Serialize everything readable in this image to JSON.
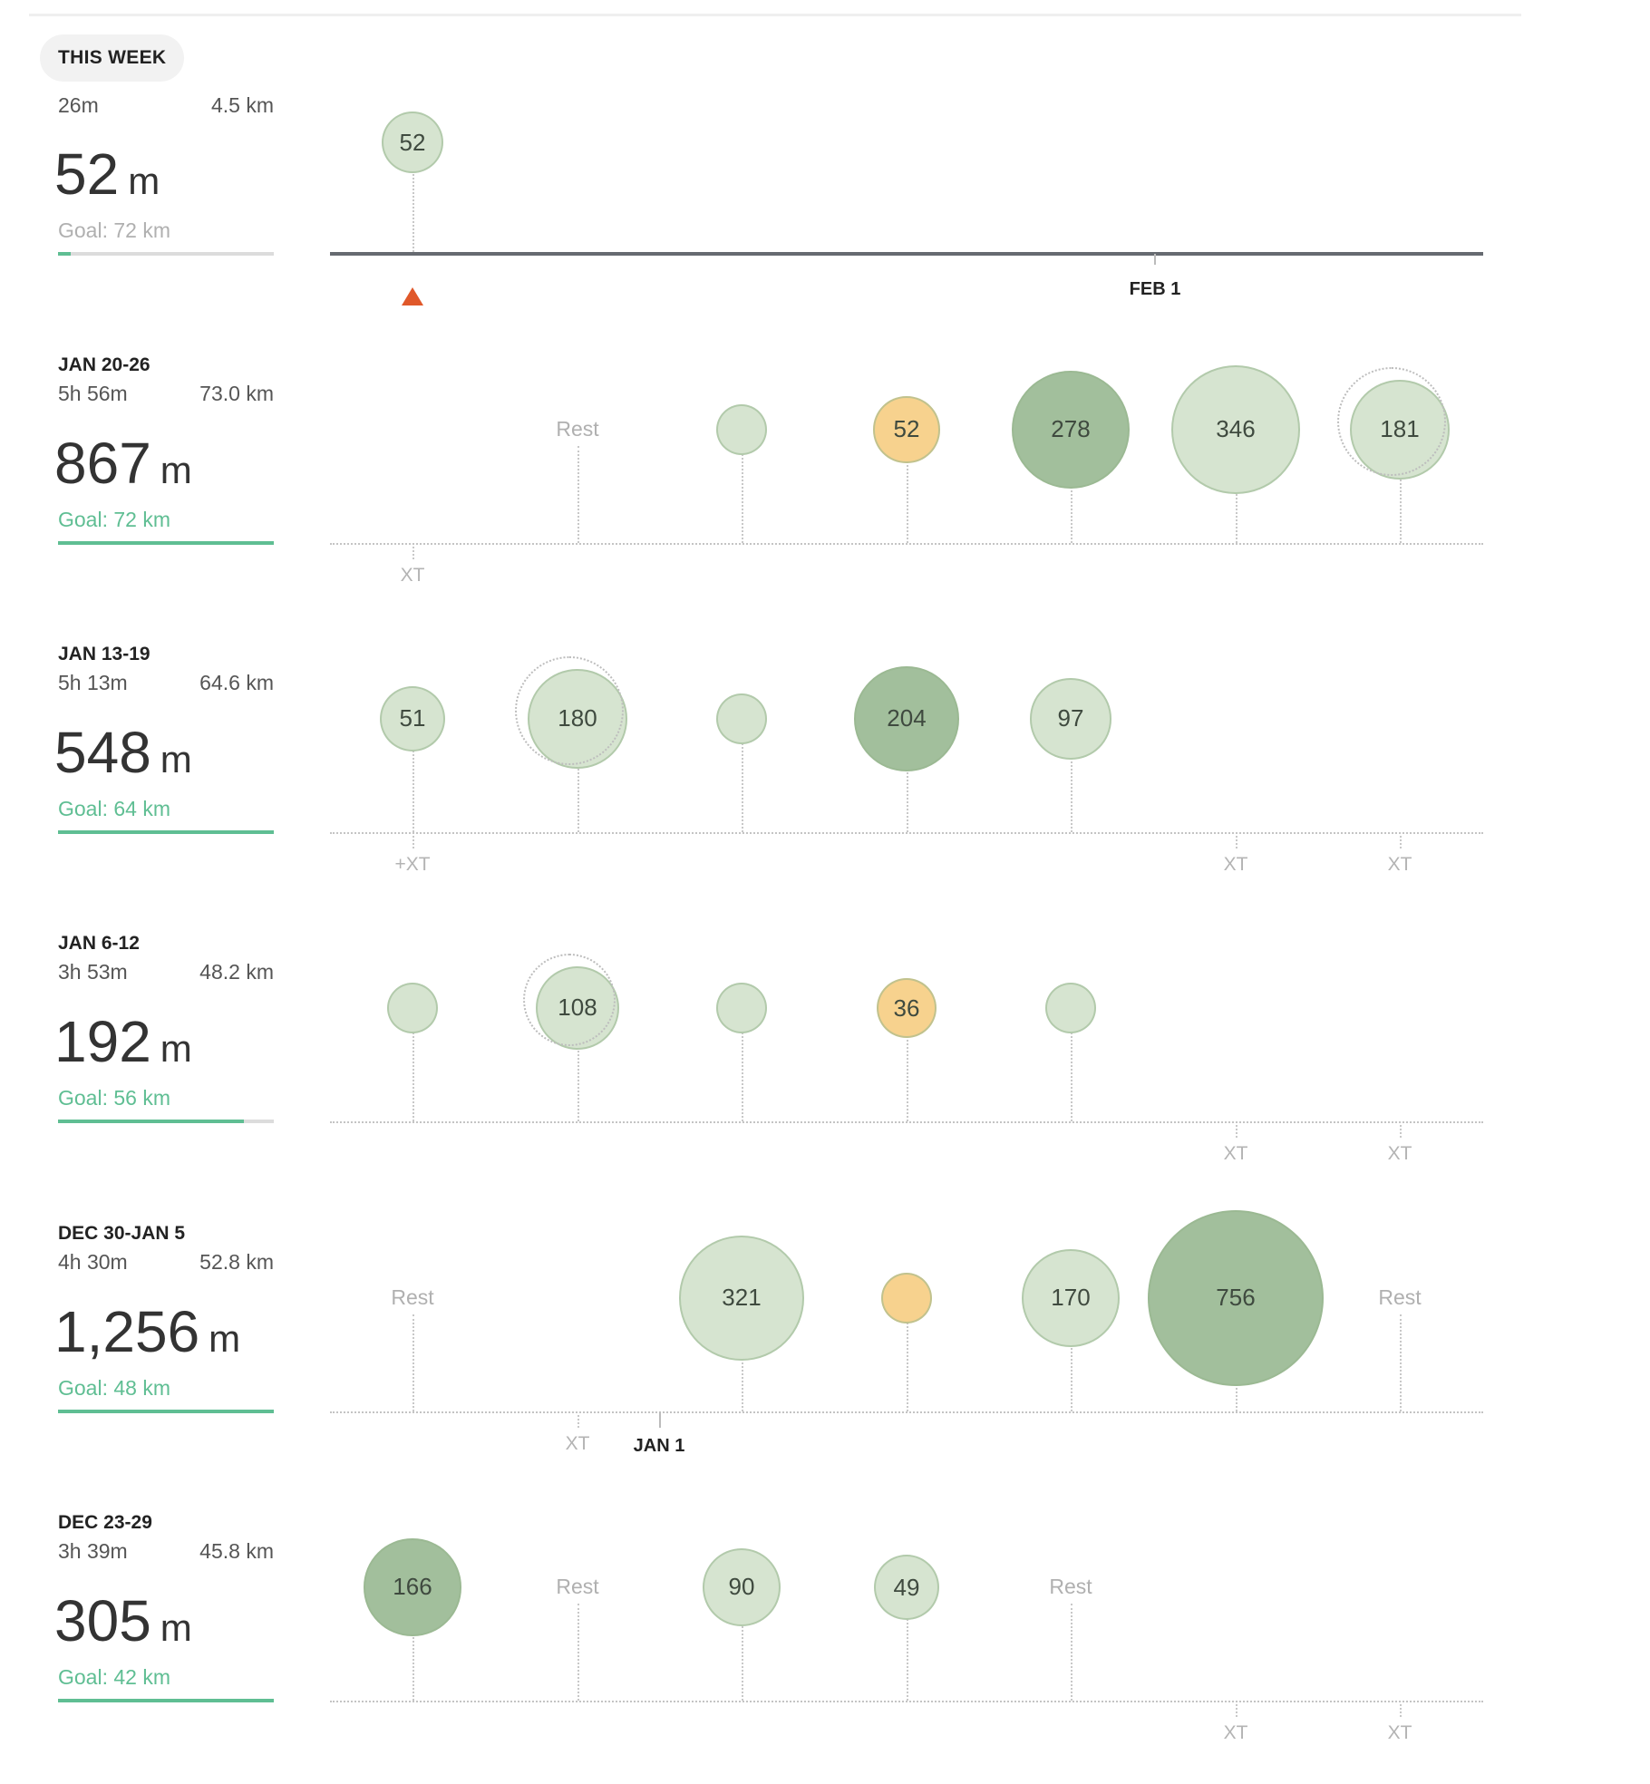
{
  "this_week": {
    "tag": "THIS WEEK",
    "time": "26m",
    "distance": "4.5 km",
    "elevation": "52",
    "unit": "m",
    "goal": "Goal: 72 km",
    "goal_progress": 0.06,
    "bubble": "52",
    "marker": "FEB 1"
  },
  "weeks": [
    {
      "label": "JAN 20-26",
      "time": "5h 56m",
      "distance": "73.0 km",
      "elevation": "867",
      "unit": "m",
      "goal": "Goal: 72 km",
      "goal_progress": 1.0,
      "days": [
        {
          "xt": "XT"
        },
        {
          "rest": "Rest"
        },
        {},
        {
          "value": "52"
        },
        {
          "value": "278"
        },
        {
          "value": "346"
        },
        {
          "value": "181"
        }
      ]
    },
    {
      "label": "JAN 13-19",
      "time": "5h 13m",
      "distance": "64.6 km",
      "elevation": "548",
      "unit": "m",
      "goal": "Goal: 64 km",
      "goal_progress": 1.0,
      "days": [
        {
          "value": "51",
          "xt": "+XT"
        },
        {
          "value": "180"
        },
        {},
        {
          "value": "204"
        },
        {
          "value": "97"
        },
        {
          "xt": "XT"
        },
        {
          "xt": "XT"
        }
      ]
    },
    {
      "label": "JAN 6-12",
      "time": "3h 53m",
      "distance": "48.2 km",
      "elevation": "192",
      "unit": "m",
      "goal": "Goal: 56 km",
      "goal_progress": 0.86,
      "days": [
        {},
        {
          "value": "108"
        },
        {},
        {
          "value": "36"
        },
        {},
        {
          "xt": "XT"
        },
        {
          "xt": "XT"
        }
      ]
    },
    {
      "label": "DEC 30-JAN 5",
      "time": "4h 30m",
      "distance": "52.8 km",
      "elevation": "1,256",
      "unit": "m",
      "goal": "Goal: 48 km",
      "goal_progress": 1.0,
      "marker": "JAN 1",
      "days": [
        {
          "rest": "Rest"
        },
        {
          "xt": "XT"
        },
        {
          "value": "321"
        },
        {},
        {
          "value": "170"
        },
        {
          "value": "756"
        },
        {
          "rest": "Rest"
        }
      ]
    },
    {
      "label": "DEC 23-29",
      "time": "3h 39m",
      "distance": "45.8 km",
      "elevation": "305",
      "unit": "m",
      "goal": "Goal: 42 km",
      "goal_progress": 1.0,
      "days": [
        {
          "value": "166"
        },
        {
          "rest": "Rest"
        },
        {
          "value": "90"
        },
        {
          "value": "49"
        },
        {
          "rest": "Rest"
        },
        {
          "xt": "XT"
        },
        {
          "xt": "XT"
        }
      ]
    }
  ],
  "colors": {
    "light_green": "#d6e4d0",
    "dark_green": "#a2bf9c",
    "orange": "#f7d28e",
    "goal_green": "#5fbe93",
    "goal_gray": "#b0b0b0",
    "today_marker": "#e0582a"
  }
}
